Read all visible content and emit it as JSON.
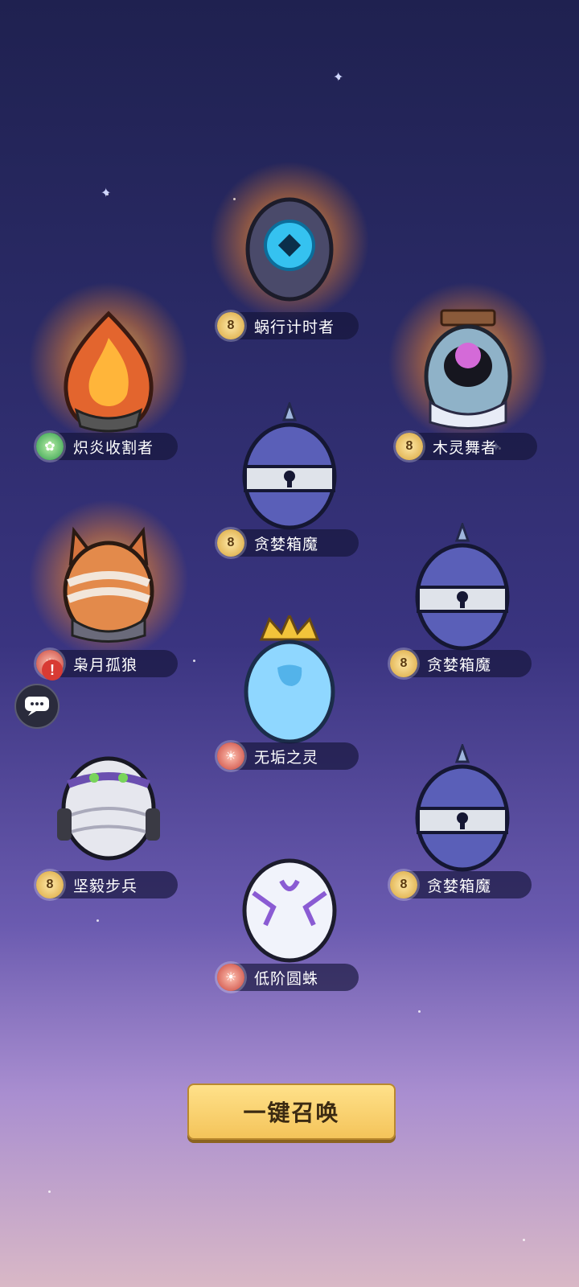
{
  "eggs": [
    {
      "name": "蜗行计时者",
      "badge": "gold",
      "glow": true,
      "style": "clock"
    },
    {
      "name": "炽炎收割者",
      "badge": "green",
      "glow": true,
      "style": "flame"
    },
    {
      "name": "木灵舞者",
      "badge": "gold",
      "glow": true,
      "style": "eye"
    },
    {
      "name": "贪婪箱魔",
      "badge": "gold",
      "glow": false,
      "style": "lock"
    },
    {
      "name": "枭月孤狼",
      "badge": "red",
      "glow": true,
      "style": "wolf"
    },
    {
      "name": "贪婪箱魔",
      "badge": "gold",
      "glow": false,
      "style": "lock"
    },
    {
      "name": "无垢之灵",
      "badge": "red",
      "glow": false,
      "style": "crown"
    },
    {
      "name": "坚毅步兵",
      "badge": "gold",
      "glow": false,
      "style": "mummy"
    },
    {
      "name": "贪婪箱魔",
      "badge": "gold",
      "glow": false,
      "style": "lock"
    },
    {
      "name": "低阶圆蛛",
      "badge": "red",
      "glow": false,
      "style": "spider"
    }
  ],
  "button": {
    "summon_label": "一键召唤"
  },
  "icons": {
    "chat": "chat-bubble-icon",
    "alert": "exclamation-icon"
  }
}
